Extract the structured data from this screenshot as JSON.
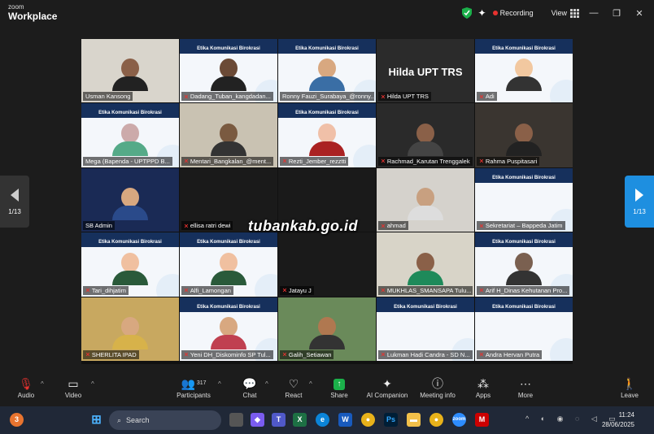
{
  "app": {
    "brand_small": "zoom",
    "brand": "Workplace"
  },
  "titlebar": {
    "recording": "Recording",
    "view": "View"
  },
  "pager": {
    "left": "1/13",
    "right": "1/13"
  },
  "slide_subtitle": "Etika Komunikasi Birokrasi",
  "plain_name_tile": "Hilda UPT TRS",
  "watermark": "tubankab.go.id",
  "participants": [
    {
      "name": "Usman Kansong",
      "muted": false
    },
    {
      "name": "Dadang_Tuban_kangdadan...",
      "muted": true
    },
    {
      "name": "Ronny Fauzi_Surabaya_@ronny...",
      "muted": false
    },
    {
      "name": "Hilda UPT TRS",
      "muted": true
    },
    {
      "name": "Adi",
      "muted": true
    },
    {
      "name": "Mega (Bapenda - UPTPPD B...",
      "muted": false
    },
    {
      "name": "Mentari_Bangkalan_@ment...",
      "muted": true
    },
    {
      "name": "Rezti_Jember_rezztti",
      "muted": true
    },
    {
      "name": "Rachmad_Karutan Trenggalek",
      "muted": true
    },
    {
      "name": "Rahma Puspitasari",
      "muted": true
    },
    {
      "name": "SB Admin",
      "muted": false
    },
    {
      "name": "ellisa ratri dewi",
      "muted": true
    },
    {
      "name": "",
      "muted": false
    },
    {
      "name": "ahmad",
      "muted": true
    },
    {
      "name": "Sekretariat – Bappeda Jatim",
      "muted": true
    },
    {
      "name": "Tari_dihjatim",
      "muted": true
    },
    {
      "name": "Alfi_Lamongan",
      "muted": true
    },
    {
      "name": "Jatayu J",
      "muted": true
    },
    {
      "name": "MUKHLAS_SMANSAPA Tulu...",
      "muted": true
    },
    {
      "name": "Arif H_Dinas Kehutanan Pro...",
      "muted": true
    },
    {
      "name": "SHERLITA IPAD",
      "muted": true
    },
    {
      "name": "Yeni DH_Diskominfo SP Tul...",
      "muted": true
    },
    {
      "name": "Galih_Setiawan",
      "muted": true
    },
    {
      "name": "Lukman Hadi Candra - SD N...",
      "muted": true
    },
    {
      "name": "Andra Hervan Putra",
      "muted": true
    }
  ],
  "toolbar": {
    "audio": "Audio",
    "video": "Video",
    "participants": "Participants",
    "participants_count": "317",
    "chat": "Chat",
    "react": "React",
    "share": "Share",
    "ai_companion": "AI Companion",
    "meeting_info": "Meeting info",
    "apps": "Apps",
    "more": "More",
    "leave": "Leave"
  },
  "taskbar": {
    "search_placeholder": "Search",
    "time": "11:24",
    "date": "28/06/2025"
  },
  "colors": {
    "active_border": "#2ecc71",
    "accent": "#1e8fe0",
    "muted": "#e8322f",
    "slide_band": "#16305c"
  }
}
